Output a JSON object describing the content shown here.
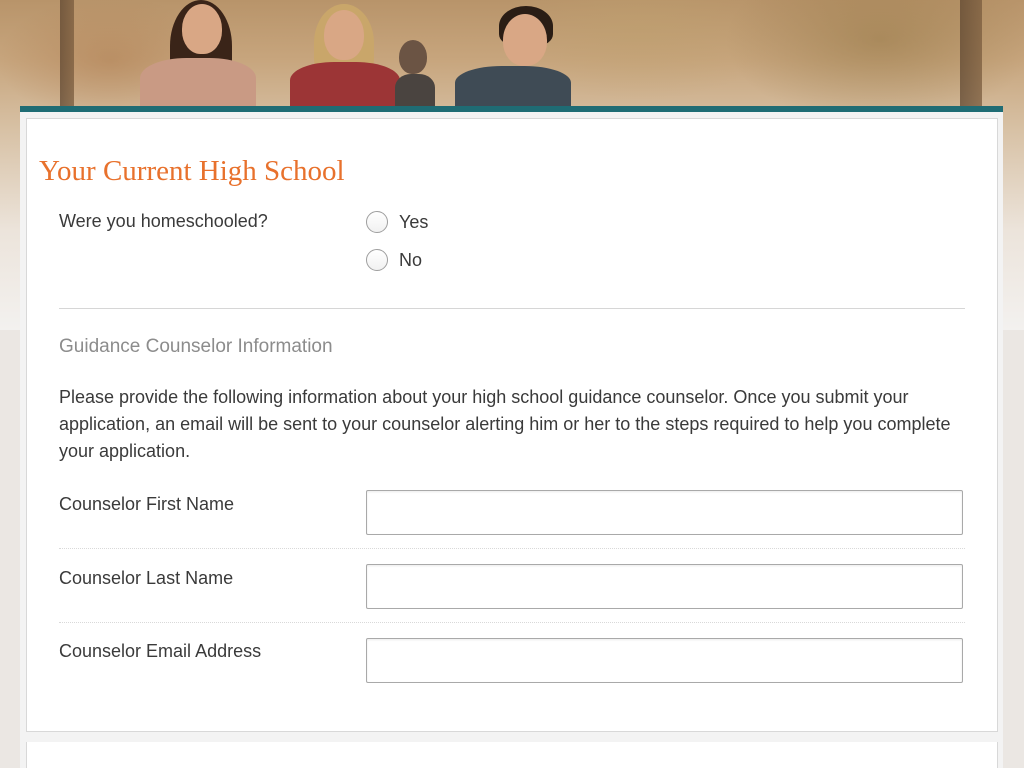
{
  "section": {
    "title": "Your Current High School"
  },
  "homeschool": {
    "question": "Were you homeschooled?",
    "options": [
      {
        "label": "Yes",
        "selected": false
      },
      {
        "label": "No",
        "selected": false
      }
    ]
  },
  "counselor": {
    "heading": "Guidance Counselor Information",
    "description": "Please provide the following information about your high school guidance counselor. Once you submit your application, an email will be sent to your counselor alerting him or her to the steps required to help you complete your application.",
    "fields": [
      {
        "label": "Counselor First Name",
        "value": "",
        "placeholder": ""
      },
      {
        "label": "Counselor Last Name",
        "value": "",
        "placeholder": ""
      },
      {
        "label": "Counselor Email Address",
        "value": "",
        "placeholder": ""
      }
    ]
  },
  "colors": {
    "accent": "#e8712c",
    "strip": "#1f6c74",
    "subheading": "#8c8c8c",
    "text": "#3a3a3a"
  },
  "banner": {
    "image": "students-walking-photo"
  }
}
